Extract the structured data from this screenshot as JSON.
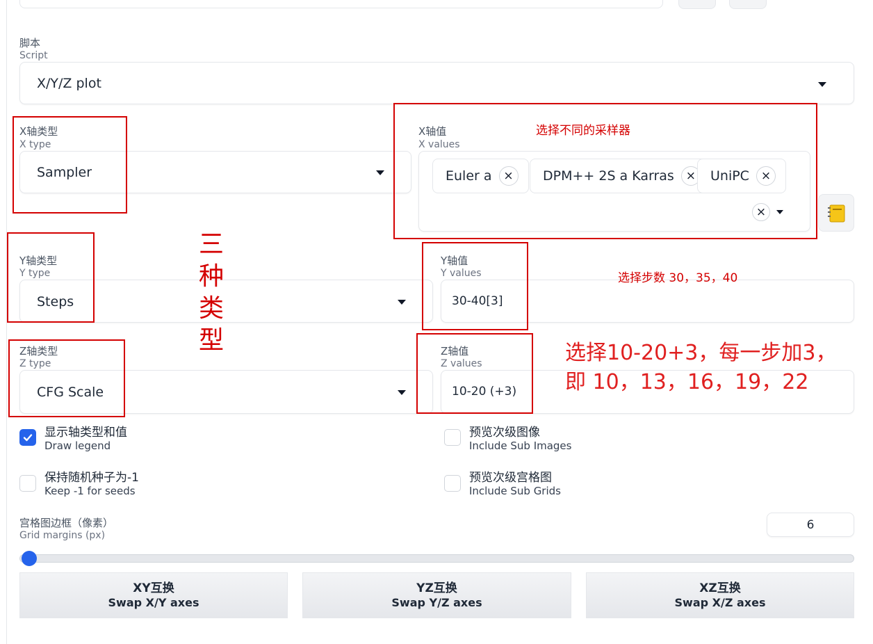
{
  "script": {
    "label_zh": "脚本",
    "label_en": "Script",
    "value": "X/Y/Z plot"
  },
  "x_type": {
    "label_zh": "X轴类型",
    "label_en": "X type",
    "value": "Sampler"
  },
  "x_values": {
    "label_zh": "X轴值",
    "label_en": "X values",
    "chips": [
      "Euler a",
      "DPM++ 2S a Karras",
      "UniPC"
    ],
    "clear_symbol": "×"
  },
  "y_type": {
    "label_zh": "Y轴类型",
    "label_en": "Y type",
    "value": "Steps"
  },
  "y_values": {
    "label_zh": "Y轴值",
    "label_en": "Y values",
    "value": "30-40[3]"
  },
  "z_type": {
    "label_zh": "Z轴类型",
    "label_en": "Z type",
    "value": "CFG Scale"
  },
  "z_values": {
    "label_zh": "Z轴值",
    "label_en": "Z values",
    "value": "10-20 (+3)"
  },
  "checkboxes": {
    "draw_legend": {
      "zh": "显示轴类型和值",
      "en": "Draw legend",
      "checked": true
    },
    "include_sub_images": {
      "zh": "预览次级图像",
      "en": "Include Sub Images",
      "checked": false
    },
    "keep_seeds": {
      "zh": "保持随机种子为-1",
      "en": "Keep -1 for seeds",
      "checked": false
    },
    "include_sub_grids": {
      "zh": "预览次级宫格图",
      "en": "Include Sub Grids",
      "checked": false
    }
  },
  "grid_margins": {
    "label_zh": "宫格图边框（像素）",
    "label_en": "Grid margins (px)",
    "value": "6",
    "slider_fraction": 0.0
  },
  "swap_buttons": {
    "xy": {
      "zh": "XY互换",
      "en": "Swap X/Y axes"
    },
    "yz": {
      "zh": "YZ互换",
      "en": "Swap Y/Z axes"
    },
    "xz": {
      "zh": "XZ互换",
      "en": "Swap X/Z axes"
    }
  },
  "annotations": {
    "sampler_note": "选择不同的采样器",
    "three_types": [
      "三",
      "种",
      "类",
      "型"
    ],
    "steps_note": "选择步数 30，35，40",
    "cfg_note_line1": "选择10-20+3，每一步加3，",
    "cfg_note_line2": "即 10，13，16，19，22"
  },
  "colors": {
    "annotation_red": "#d40000",
    "checkbox_blue": "#2563eb"
  }
}
